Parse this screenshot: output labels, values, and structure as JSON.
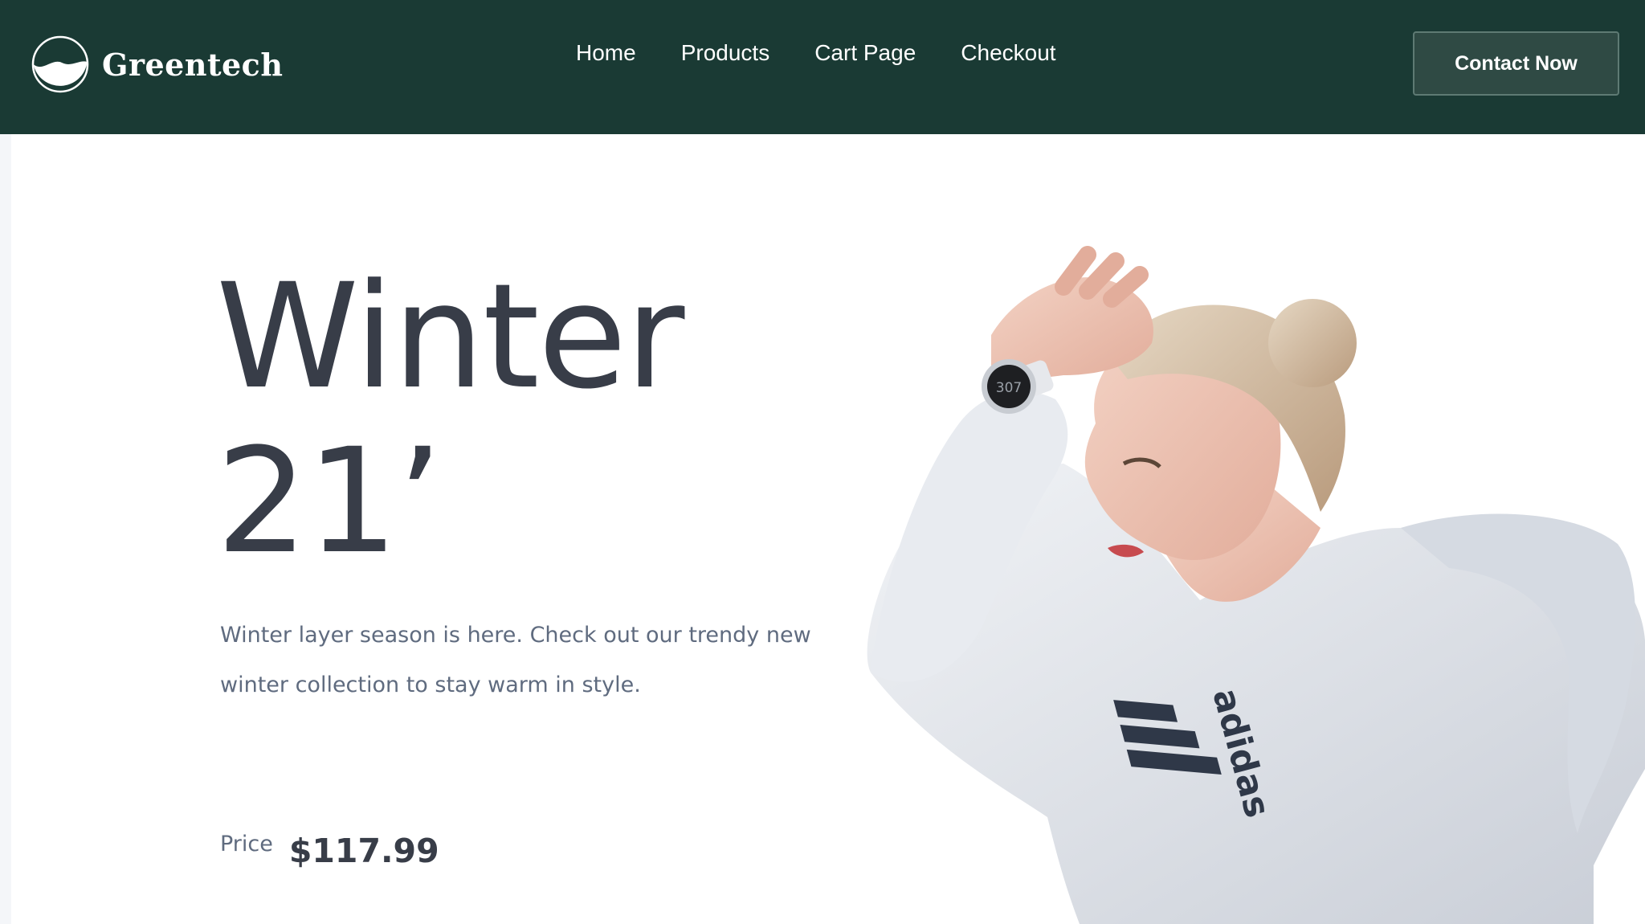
{
  "header": {
    "brand_name": "Greentech",
    "nav": [
      {
        "label": "Home"
      },
      {
        "label": "Products"
      },
      {
        "label": "Cart Page"
      },
      {
        "label": "Checkout"
      }
    ],
    "contact_label": "Contact Now"
  },
  "hero": {
    "title_line1": "Winter",
    "title_line2": "21’",
    "description": "Winter layer season is here. Check out our trendy new winter collection to stay warm in style.",
    "price_label": "Price",
    "price_value": "$117.99",
    "image_icon": "model-photo",
    "garment_logo_text": "adidas",
    "watch_display_text": "307"
  },
  "colors": {
    "nav_background": "#1a3a34",
    "button_background": "#2f4a44",
    "heading_text": "#383d48",
    "body_text": "#5f6b7f",
    "page_background": "#ffffff"
  }
}
